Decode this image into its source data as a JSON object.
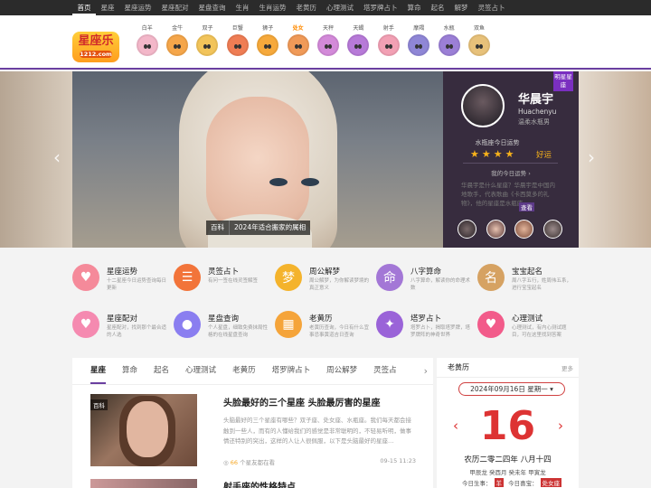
{
  "topnav": [
    "首页",
    "星座",
    "星座运势",
    "星座配对",
    "星盘查询",
    "生肖",
    "生肖运势",
    "老黄历",
    "心理测试",
    "塔罗牌占卜",
    "算命",
    "起名",
    "解梦",
    "灵签占卜"
  ],
  "logo": {
    "text": "星座乐",
    "sub": "1212.com"
  },
  "zodiacs": [
    {
      "name": "白羊",
      "color": "#f3b7c9"
    },
    {
      "name": "金牛",
      "color": "#f5a64a"
    },
    {
      "name": "双子",
      "color": "#f2c45a"
    },
    {
      "name": "巨蟹",
      "color": "#ef7d54"
    },
    {
      "name": "狮子",
      "color": "#f6a93b"
    },
    {
      "name": "处女",
      "color": "#f09a58",
      "hot": true
    },
    {
      "name": "天秤",
      "color": "#d38ad9"
    },
    {
      "name": "天蝎",
      "color": "#b77ad8"
    },
    {
      "name": "射手",
      "color": "#f2a0b4"
    },
    {
      "name": "摩羯",
      "color": "#8f86d6"
    },
    {
      "name": "水瓶",
      "color": "#9b7fd6"
    },
    {
      "name": "双鱼",
      "color": "#e7c17a"
    }
  ],
  "banner": {
    "tag": "百科",
    "caption": "2024年适合搬家的属相",
    "prev": "‹",
    "next": "›"
  },
  "celebrity": {
    "badge": "明星星座",
    "name": "华晨宇",
    "en": "Huachenyu",
    "desc": "温柔水瓶男",
    "label": "水瓶座今日运势",
    "stars": "★★★★",
    "luck": "好运",
    "fortune": "我的今日运势 ›",
    "text": "华晨宇是什么星座？华晨宇是中国内地歌手，代表歌曲《卡西莫多的礼物》，他的星座是水瓶座…",
    "more": "查看"
  },
  "categories": [
    {
      "title": "星座运势",
      "sub": "十二星座今日运势查询每日更新",
      "icon": "♥",
      "color": "#f58a9a"
    },
    {
      "title": "灵签占卜",
      "sub": "有问一签在线灵签解签",
      "icon": "☰",
      "color": "#f2743a"
    },
    {
      "title": "周公解梦",
      "sub": "周公解梦，为你解读梦境的真正意义",
      "icon": "梦",
      "color": "#f4b32c"
    },
    {
      "title": "八字算命",
      "sub": "八字算命，解读你的命理术数",
      "icon": "命",
      "color": "#a377d6"
    },
    {
      "title": "宝宝起名",
      "sub": "周八字五行，姓周伟五系，进行宝宝起名",
      "icon": "名",
      "color": "#d6a262"
    },
    {
      "title": "星座配对",
      "sub": "星座配对，找到那个最合适的人选",
      "icon": "♥",
      "color": "#f58ab0"
    },
    {
      "title": "星盘查询",
      "sub": "个人星盘，细致免费抹局性格的在线星盘查询",
      "icon": "●",
      "color": "#8a7ef0"
    },
    {
      "title": "老黄历",
      "sub": "老黄历查询，今日有什么宜事忌事黄道吉日查询",
      "icon": "▦",
      "color": "#f5a43a"
    },
    {
      "title": "塔罗占卜",
      "sub": "塔罗占卜，揭取塔罗牌，塔罗牌阵的神奇世界",
      "icon": "✦",
      "color": "#9a63d8"
    },
    {
      "title": "心理测试",
      "sub": "心理测试，有内心测试题目，可在这里找到答案",
      "icon": "♥",
      "color": "#f25b8a"
    }
  ],
  "tabs": [
    "星座",
    "算命",
    "起名",
    "心理测试",
    "老黄历",
    "塔罗牌占卜",
    "周公解梦",
    "灵签占"
  ],
  "tab_arrow": "›",
  "article": {
    "tag": "百科",
    "title": "头脸最好的三个星座 头脸最厉害的星座",
    "desc": "头脑最好的三个星座有哪些？双子座、处女座、水瓶座。我们每天都会接触到一些人，而有的人懂给我们的感觉是非常聪明的，不轻易听明，做事情还特别的突出，这样的人让人很佩服，以下是头脑最好的星座…",
    "views": "66",
    "views_label": "个星友都在看",
    "date": "09-15 11:23"
  },
  "article2": {
    "title": "射手座的性格特点"
  },
  "almanac": {
    "title": "老黄历",
    "more": "更多",
    "date": "2024年09月16日 星期一",
    "day": "16",
    "lunar": "农历二零二四年 八月十四",
    "ganzhi": "甲辰龙 癸酉月 癸未年 甲寅龙",
    "yi_label": "今日生事：",
    "yi": "羊",
    "ji_label": "今日喜宝：",
    "ji": "处女座"
  }
}
